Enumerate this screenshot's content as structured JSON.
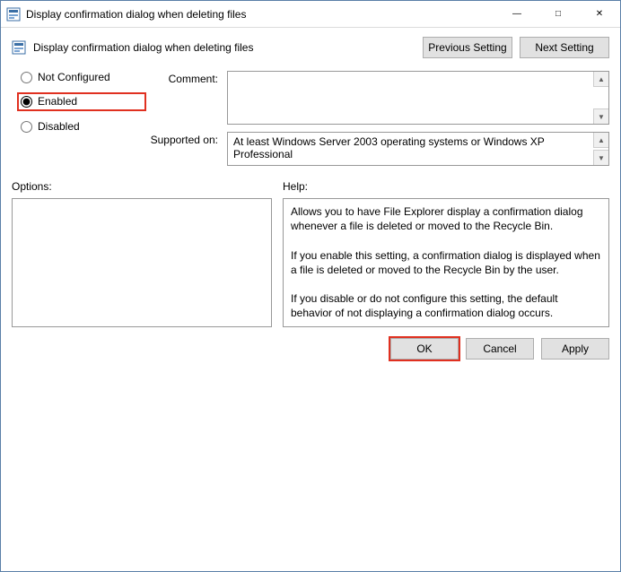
{
  "window": {
    "title": "Display confirmation dialog when deleting files"
  },
  "header": {
    "dialog_title": "Display confirmation dialog when deleting files",
    "previous_btn": "Previous Setting",
    "next_btn": "Next Setting"
  },
  "state": {
    "not_configured": "Not Configured",
    "enabled": "Enabled",
    "disabled": "Disabled"
  },
  "form": {
    "comment_label": "Comment:",
    "comment_value": "",
    "supported_label": "Supported on:",
    "supported_value": "At least Windows Server 2003 operating systems or Windows XP Professional"
  },
  "labels": {
    "options": "Options:",
    "help": "Help:"
  },
  "help_text": "Allows you to have File Explorer display a confirmation dialog whenever a file is deleted or moved to the Recycle Bin.\n\nIf you enable this setting, a confirmation dialog is displayed when a file is deleted or moved to the Recycle Bin by the user.\n\nIf you disable or do not configure this setting, the default behavior of not displaying a confirmation dialog occurs.",
  "footer": {
    "ok": "OK",
    "cancel": "Cancel",
    "apply": "Apply"
  }
}
